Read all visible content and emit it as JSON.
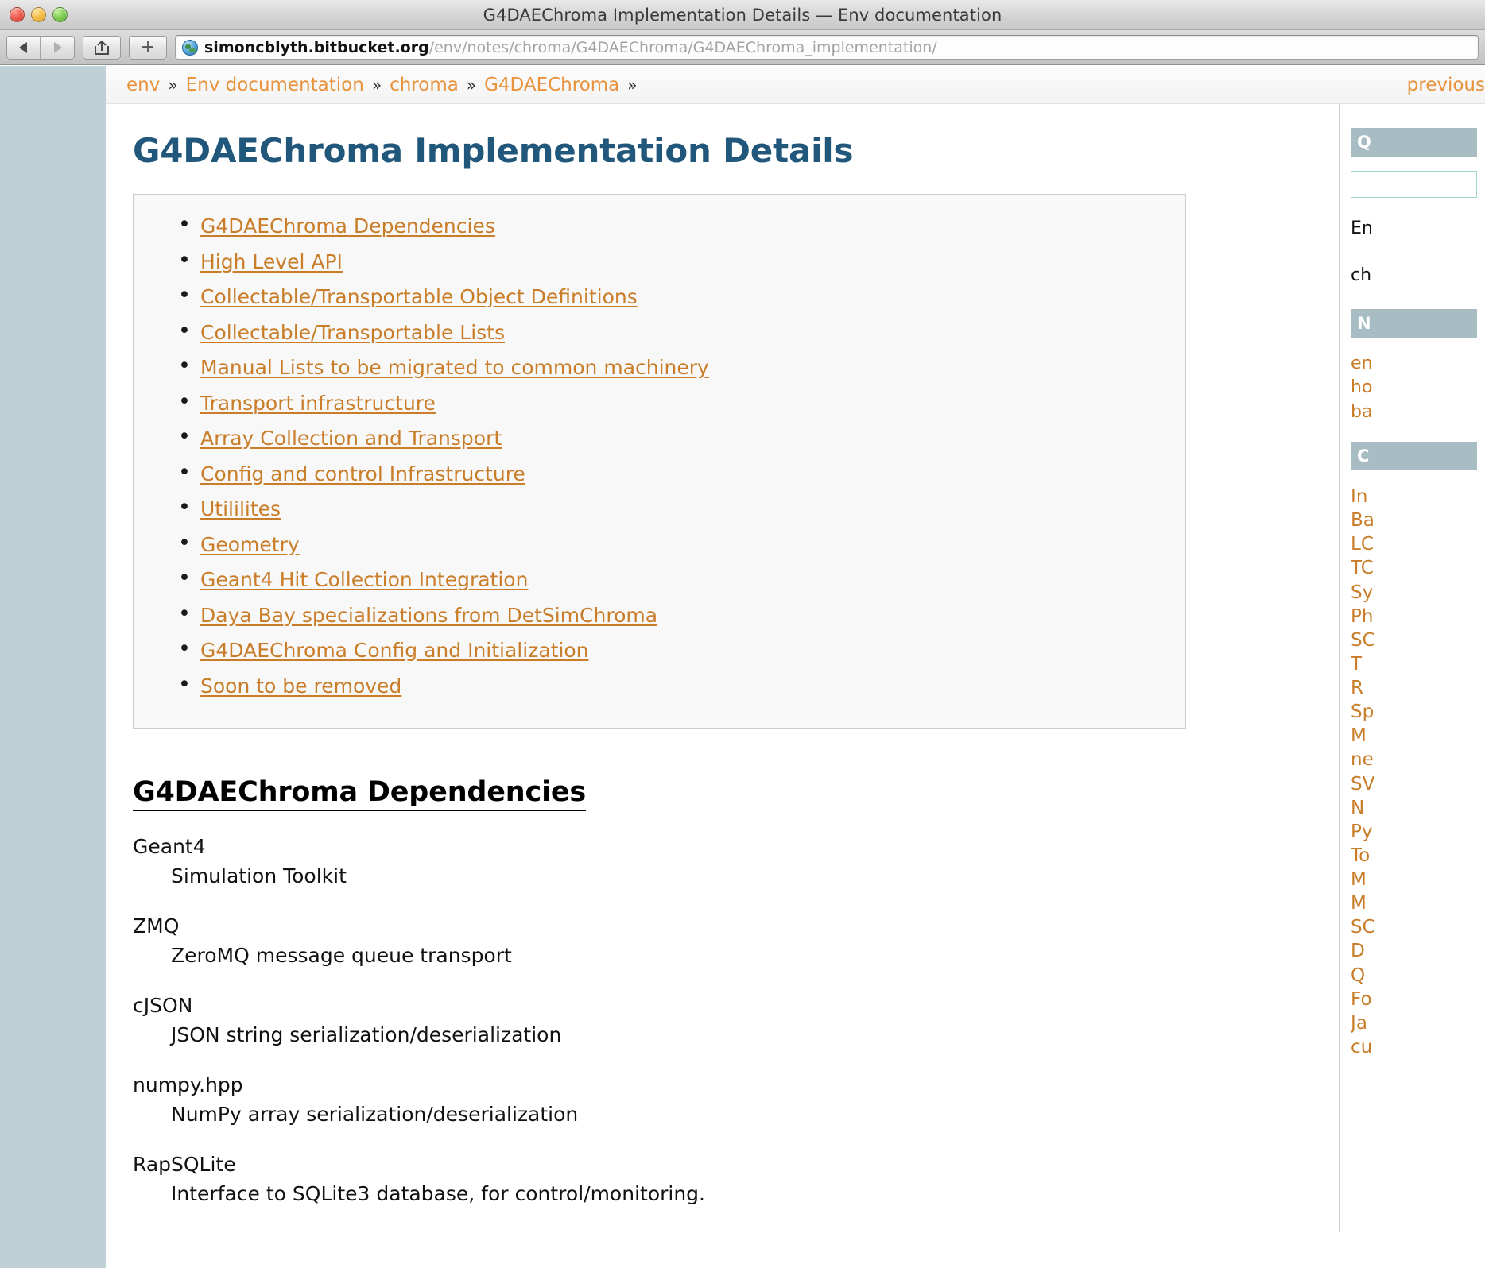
{
  "window": {
    "title": "G4DAEChroma Implementation Details — Env documentation",
    "controls": {
      "close": "close",
      "minimize": "minimize",
      "zoom": "zoom"
    }
  },
  "toolbar": {
    "back_label": "◀",
    "forward_label": "▶",
    "share_label": "share-icon",
    "add_label": "+",
    "url_host": "simoncblyth.bitbucket.org",
    "url_path": "/env/notes/chroma/G4DAEChroma/G4DAEChroma_implementation/",
    "globe_icon": "globe-icon"
  },
  "relbar": {
    "breadcrumb": [
      {
        "label": "env"
      },
      {
        "label": "Env documentation"
      },
      {
        "label": "chroma"
      },
      {
        "label": "G4DAEChroma"
      }
    ],
    "separator": "»",
    "trailing_separator": "»",
    "previous_label": "previous"
  },
  "main": {
    "page_title": "G4DAEChroma Implementation Details",
    "toc": [
      "G4DAEChroma Dependencies",
      "High Level API",
      "Collectable/Transportable Object Definitions",
      "Collectable/Transportable Lists",
      "Manual Lists to be migrated to common machinery",
      "Transport infrastructure",
      "Array Collection and Transport",
      "Config and control Infrastructure",
      "Utililites",
      "Geometry",
      "Geant4 Hit Collection Integration",
      "Daya Bay specializations from DetSimChroma",
      "G4DAEChroma Config and Initialization",
      "Soon to be removed"
    ],
    "section_heading": "G4DAEChroma Dependencies",
    "dependencies": [
      {
        "term": "Geant4",
        "definition": "Simulation Toolkit"
      },
      {
        "term": "ZMQ",
        "definition": "ZeroMQ message queue transport"
      },
      {
        "term": "cJSON",
        "definition": "JSON string serialization/deserialization"
      },
      {
        "term": "numpy.hpp",
        "definition": "NumPy array serialization/deserialization"
      },
      {
        "term": "RapSQLite",
        "definition": "Interface to SQLite3 database, for control/monitoring."
      }
    ]
  },
  "sidebar": {
    "quick_search_heading": "Q",
    "search_value": "",
    "intro_lines": [
      "En",
      "ch"
    ],
    "navigation_heading": "N",
    "nav_links": [
      "en",
      "ho",
      "ba"
    ],
    "contents_heading": "C",
    "toc_links": [
      "In",
      "Ba",
      "LC",
      "TC",
      "Sy",
      "Ph",
      "SC",
      "T",
      "R",
      "Sp",
      "M",
      "ne",
      "SV",
      "N",
      "Py",
      "To",
      "M",
      "M",
      "SC",
      "D",
      "Q",
      "Fo",
      "Ja",
      "cu"
    ]
  },
  "colors": {
    "link_orange": "#c97d28",
    "breadcrumb_orange": "#e8923c",
    "title_blue": "#20577a",
    "gutter": "#bfd0d6",
    "toc_box_bg": "#f8f8f8",
    "sidebar_heading_bg": "#a8bcc4"
  }
}
